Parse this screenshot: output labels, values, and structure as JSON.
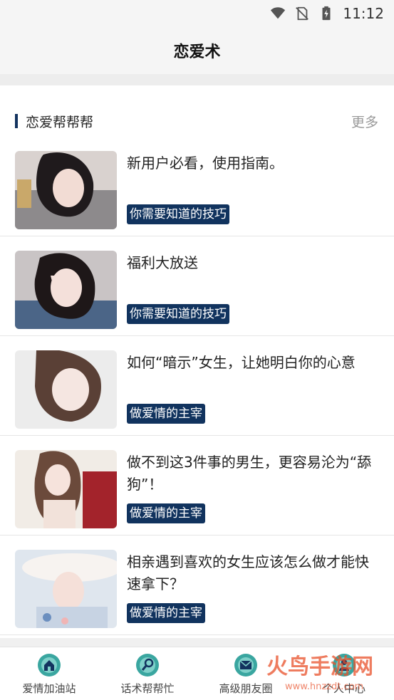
{
  "status_bar": {
    "time": "11:12",
    "icons": [
      "wifi-icon",
      "no-sim-icon",
      "battery-charging-icon"
    ]
  },
  "header": {
    "title": "恋爱术"
  },
  "section": {
    "title": "恋爱帮帮帮",
    "more_label": "更多"
  },
  "articles": [
    {
      "title": "新用户必看，使用指南。",
      "tag": "你需要知道的技巧"
    },
    {
      "title": "福利大放送",
      "tag": "你需要知道的技巧"
    },
    {
      "title": "如何“暗示”女生，让她明白你的心意",
      "tag": "做爱情的主宰"
    },
    {
      "title": "做不到这3件事的男生，更容易沦为“舔狗”！",
      "tag": "做爱情的主宰"
    },
    {
      "title": "相亲遇到喜欢的女生应该怎么做才能快速拿下？",
      "tag": "做爱情的主宰"
    }
  ],
  "tabs": [
    {
      "label": "爱情加油站",
      "icon": "home-icon"
    },
    {
      "label": "话术帮帮忙",
      "icon": "search-icon"
    },
    {
      "label": "高级朋友圈",
      "icon": "mail-icon"
    },
    {
      "label": "个人中心",
      "icon": "person-icon"
    }
  ],
  "watermark": {
    "text": "火鸟手游网",
    "url": "www.hnzzdt.com"
  },
  "colors": {
    "accent": "#13335f",
    "tab_icon": "#3aa6a0"
  }
}
